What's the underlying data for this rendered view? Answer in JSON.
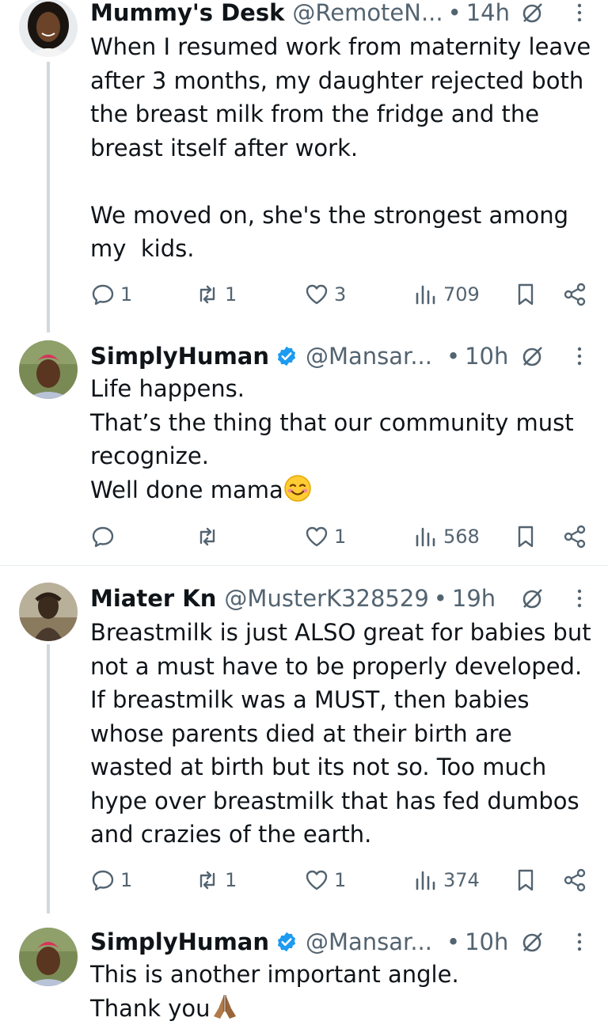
{
  "colors": {
    "text": "#0f1419",
    "muted": "#536471",
    "verified": "#1d9bf0",
    "line": "#cfd9de"
  },
  "tweets": [
    {
      "name": "Mummy's Desk",
      "handle": "@RemoteN...",
      "time": "14h",
      "verified": false,
      "body": "When I resumed work from maternity leave\nafter 3 months, my daughter rejected both\nthe breast milk from the fridge and the\nbreast itself after work.\n\nWe moved on, she's the strongest among\nmy  kids.",
      "replies": "1",
      "retweets": "1",
      "likes": "3",
      "views": "709"
    },
    {
      "name": "SimplyHuman",
      "handle": "@Mansar...",
      "time": "10h",
      "verified": true,
      "body": "Life happens.\nThat’s the thing that our community must\nrecognize.\nWell done mama",
      "replies": "",
      "retweets": "",
      "likes": "1",
      "views": "568"
    },
    {
      "name": "Miater Kn",
      "handle": "@MusterK328529",
      "time": "19h",
      "verified": false,
      "body": "Breastmilk is just ALSO great for babies but\nnot a must have to be properly developed.\nIf breastmilk was a MUST, then babies\nwhose parents died at their birth are\nwasted at birth but its not so. Too much\nhype over breastmilk that has fed dumbos\nand crazies of the earth.",
      "replies": "1",
      "retweets": "1",
      "likes": "1",
      "views": "374"
    },
    {
      "name": "SimplyHuman",
      "handle": "@Mansar...",
      "time": "10h",
      "verified": true,
      "body": "This is another important angle.\nThank you",
      "replies": "",
      "retweets": "",
      "likes": "",
      "views": ""
    }
  ],
  "separator": "•"
}
